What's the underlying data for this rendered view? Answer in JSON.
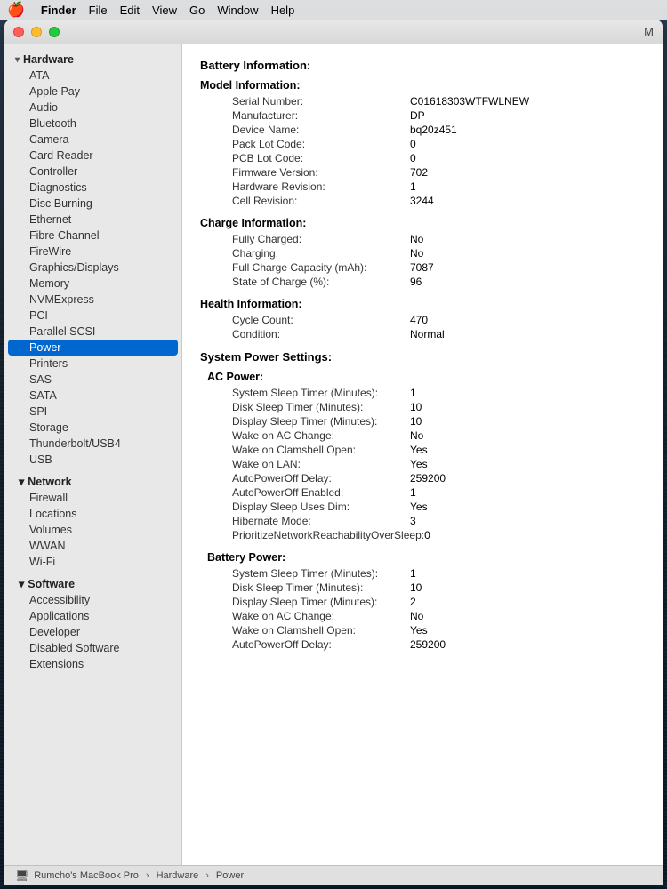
{
  "menubar": {
    "apple": "🍎",
    "items": [
      "Finder",
      "File",
      "Edit",
      "View",
      "Go",
      "Window",
      "Help"
    ]
  },
  "window": {
    "title": "M"
  },
  "trafficLights": {
    "close": "close",
    "minimize": "minimize",
    "maximize": "maximize"
  },
  "sidebar": {
    "hardware_header": "Hardware",
    "hardware_items": [
      "ATA",
      "Apple Pay",
      "Audio",
      "Bluetooth",
      "Camera",
      "Card Reader",
      "Controller",
      "Diagnostics",
      "Disc Burning",
      "Ethernet",
      "Fibre Channel",
      "FireWire",
      "Graphics/Displays",
      "Memory",
      "NVMExpress",
      "PCI",
      "Parallel SCSI",
      "Power",
      "Printers",
      "SAS",
      "SATA",
      "SPI",
      "Storage",
      "Thunderbolt/USB4",
      "USB"
    ],
    "network_header": "Network",
    "network_items": [
      "Firewall",
      "Locations",
      "Volumes",
      "WWAN",
      "Wi-Fi"
    ],
    "software_header": "Software",
    "software_items": [
      "Accessibility",
      "Applications",
      "Developer",
      "Disabled Software",
      "Extensions"
    ],
    "selected_item": "Power"
  },
  "main": {
    "battery_title": "Battery Information:",
    "model_info_title": "Model Information:",
    "serial_number_label": "Serial Number:",
    "serial_number_value": "C01618303WTFWLNEW",
    "manufacturer_label": "Manufacturer:",
    "manufacturer_value": "DP",
    "device_name_label": "Device Name:",
    "device_name_value": "bq20z451",
    "pack_lot_label": "Pack Lot Code:",
    "pack_lot_value": "0",
    "pcb_lot_label": "PCB Lot Code:",
    "pcb_lot_value": "0",
    "firmware_label": "Firmware Version:",
    "firmware_value": "702",
    "hardware_rev_label": "Hardware Revision:",
    "hardware_rev_value": "1",
    "cell_rev_label": "Cell Revision:",
    "cell_rev_value": "3244",
    "charge_info_title": "Charge Information:",
    "fully_charged_label": "Fully Charged:",
    "fully_charged_value": "No",
    "charging_label": "Charging:",
    "charging_value": "No",
    "full_charge_label": "Full Charge Capacity (mAh):",
    "full_charge_value": "7087",
    "state_charge_label": "State of Charge (%):",
    "state_charge_value": "96",
    "health_info_title": "Health Information:",
    "cycle_count_label": "Cycle Count:",
    "cycle_count_value": "470",
    "condition_label": "Condition:",
    "condition_value": "Normal",
    "system_power_title": "System Power Settings:",
    "ac_power_title": "AC Power:",
    "sys_sleep_label": "System Sleep Timer (Minutes):",
    "sys_sleep_value": "1",
    "disk_sleep_label": "Disk Sleep Timer (Minutes):",
    "disk_sleep_value": "10",
    "display_sleep_label": "Display Sleep Timer (Minutes):",
    "display_sleep_value": "10",
    "wake_ac_label": "Wake on AC Change:",
    "wake_ac_value": "No",
    "wake_clamshell_label": "Wake on Clamshell Open:",
    "wake_clamshell_value": "Yes",
    "wake_lan_label": "Wake on LAN:",
    "wake_lan_value": "Yes",
    "auto_power_delay_label": "AutoPowerOff Delay:",
    "auto_power_delay_value": "259200",
    "auto_power_enabled_label": "AutoPowerOff Enabled:",
    "auto_power_enabled_value": "1",
    "display_sleep_dim_label": "Display Sleep Uses Dim:",
    "display_sleep_dim_value": "Yes",
    "hibernate_label": "Hibernate Mode:",
    "hibernate_value": "3",
    "prioritize_label": "PrioritizeNetworkReachabilityOverSleep:",
    "prioritize_value": "0",
    "battery_power_title": "Battery Power:",
    "bat_sys_sleep_label": "System Sleep Timer (Minutes):",
    "bat_sys_sleep_value": "1",
    "bat_disk_sleep_label": "Disk Sleep Timer (Minutes):",
    "bat_disk_sleep_value": "10",
    "bat_display_sleep_label": "Display Sleep Timer (Minutes):",
    "bat_display_sleep_value": "2",
    "bat_wake_ac_label": "Wake on AC Change:",
    "bat_wake_ac_value": "No",
    "bat_wake_clamshell_label": "Wake on Clamshell Open:",
    "bat_wake_clamshell_value": "Yes",
    "bat_auto_power_delay_label": "AutoPowerOff Delay:",
    "bat_auto_power_delay_value": "259200"
  },
  "statusbar": {
    "icon": "🖥",
    "breadcrumb1": "Rumcho's MacBook Pro",
    "sep1": "›",
    "breadcrumb2": "Hardware",
    "sep2": "›",
    "breadcrumb3": "Power"
  }
}
